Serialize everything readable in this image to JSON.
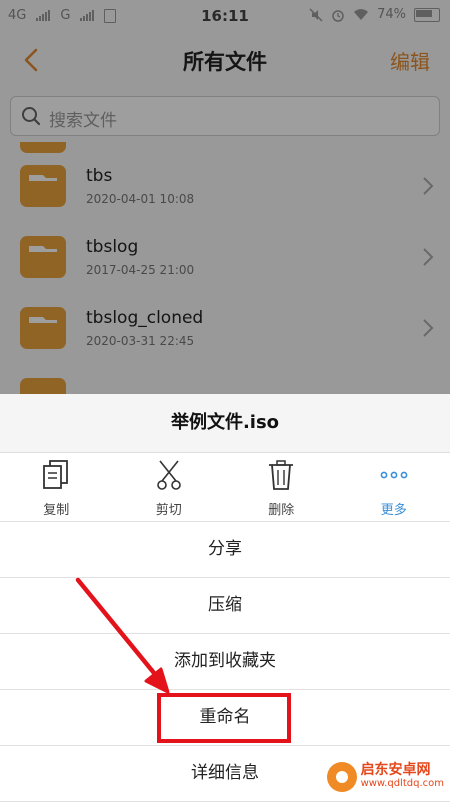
{
  "status_bar": {
    "network_1": "4G",
    "network_2": "G",
    "time": "16:11",
    "battery": "74%"
  },
  "header": {
    "title": "所有文件",
    "edit_label": "编辑"
  },
  "search": {
    "placeholder": "搜索文件"
  },
  "files": [
    {
      "name": "tbs",
      "date": "2020-04-01 10:08"
    },
    {
      "name": "tbslog",
      "date": "2017-04-25 21:00"
    },
    {
      "name": "tbslog_cloned",
      "date": "2020-03-31 22:45"
    }
  ],
  "sheet": {
    "title": "举例文件.iso",
    "actions": [
      {
        "label": "复制",
        "icon": "copy-icon"
      },
      {
        "label": "剪切",
        "icon": "scissors-icon"
      },
      {
        "label": "删除",
        "icon": "trash-icon"
      },
      {
        "label": "更多",
        "icon": "more-dots-icon"
      }
    ],
    "menu": [
      {
        "label": "分享"
      },
      {
        "label": "压缩"
      },
      {
        "label": "添加到收藏夹"
      },
      {
        "label": "重命名"
      },
      {
        "label": "详细信息"
      }
    ]
  },
  "watermark": {
    "name": "启东安卓网",
    "url": "www.qdltdq.com"
  },
  "colors": {
    "accent_orange": "#e08a2f",
    "folder": "#e8a23a",
    "highlight_red": "#e3121b",
    "more_blue": "#3a8fd8"
  }
}
